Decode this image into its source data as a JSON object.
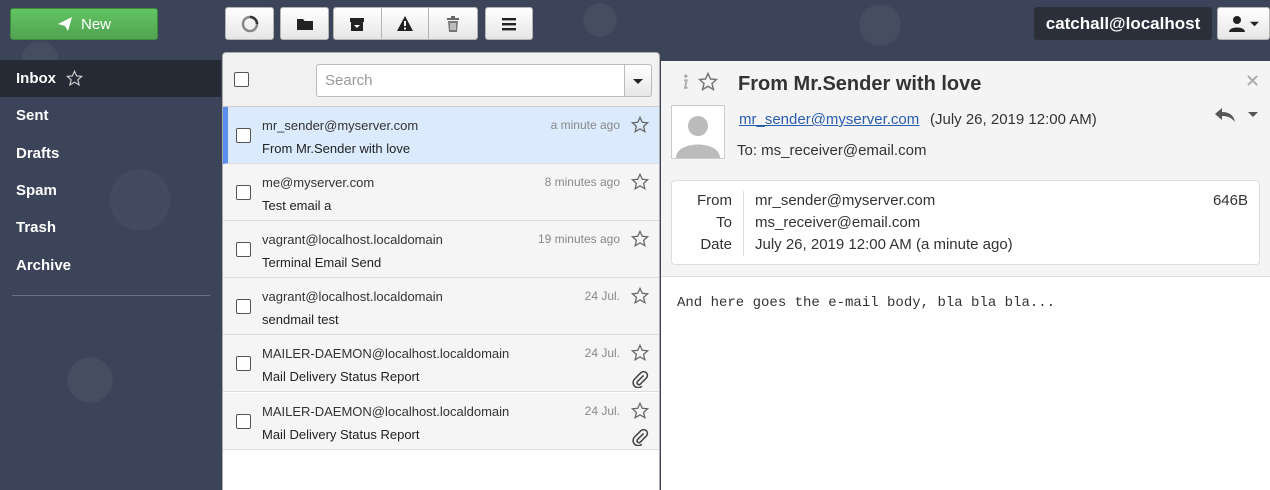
{
  "toolbar": {
    "new_label": "New",
    "account": "catchall@localhost"
  },
  "sidebar": {
    "items": [
      {
        "label": "Inbox",
        "active": true
      },
      {
        "label": "Sent"
      },
      {
        "label": "Drafts"
      },
      {
        "label": "Spam"
      },
      {
        "label": "Trash"
      },
      {
        "label": "Archive"
      }
    ]
  },
  "search": {
    "placeholder": "Search"
  },
  "messages": [
    {
      "from": "mr_sender@myserver.com",
      "date": "a minute ago",
      "subject": "From Mr.Sender with love"
    },
    {
      "from": "me@myserver.com",
      "date": "8 minutes ago",
      "subject": "Test email a"
    },
    {
      "from": "vagrant@localhost.localdomain",
      "date": "19 minutes ago",
      "subject": "Terminal Email Send"
    },
    {
      "from": "vagrant@localhost.localdomain",
      "date": "24 Jul.",
      "subject": "sendmail test"
    },
    {
      "from": "MAILER-DAEMON@localhost.localdomain",
      "date": "24 Jul.",
      "subject": "Mail Delivery Status Report"
    },
    {
      "from": "MAILER-DAEMON@localhost.localdomain",
      "date": "24 Jul.",
      "subject": "Mail Delivery Status Report"
    }
  ],
  "preview": {
    "title": "From Mr.Sender with love",
    "sender": "mr_sender@myserver.com",
    "sender_date": "(July 26, 2019 12:00 AM)",
    "to_line": "To: ms_receiver@email.com",
    "details": {
      "from_label": "From",
      "from": "mr_sender@myserver.com",
      "to_label": "To",
      "to": "ms_receiver@email.com",
      "date_label": "Date",
      "date": "July 26, 2019 12:00 AM (a minute ago)",
      "size": "646B"
    },
    "body": "And here goes the e-mail body, bla bla bla..."
  }
}
